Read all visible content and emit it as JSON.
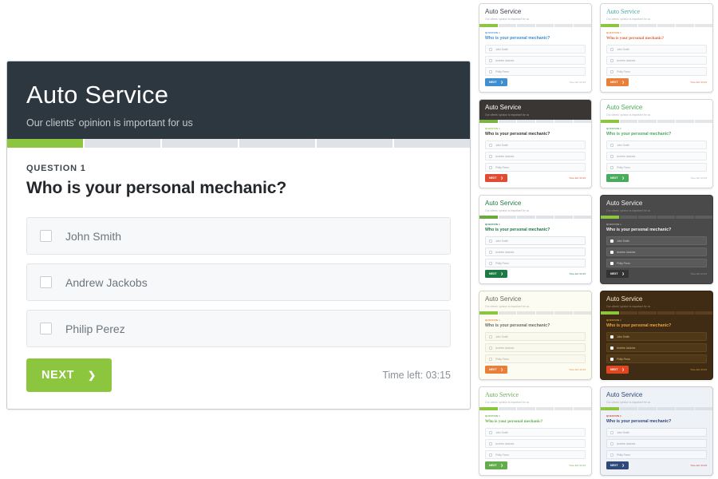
{
  "survey": {
    "title": "Auto Service",
    "subtitle": "Our clients' opinion is important for us",
    "question_label": "QUESTION 1",
    "question": "Who is your personal mechanic?",
    "options": [
      {
        "label": "John Smith",
        "checked": false
      },
      {
        "label": "Andrew Jackobs",
        "checked": false
      },
      {
        "label": "Philip Perez",
        "checked": false
      }
    ],
    "next_label": "NEXT",
    "next_icon": "chevron-right-icon",
    "time_left": "Time left: 03:15",
    "progress": {
      "total_steps": 6,
      "completed_steps": 1,
      "percent": 17
    }
  },
  "theme": {
    "header_bg": "#2d3740",
    "accent": "#8cc63e",
    "option_bg": "#f7f8f9",
    "card_bg": "#ffffff"
  },
  "variants": [
    {
      "name": "light-blue",
      "card_bg": "#ffffff",
      "head_bg": "#ffffff",
      "title_color": "#3d4550",
      "sub_color": "#9aa1a8",
      "title_font": "sans",
      "accent": "#8cc63e",
      "track": "#e3e6e9",
      "qlabel_color": "#3f8fd0",
      "qtitle_color": "#3f8fd0",
      "opt_bg": "#fafbfc",
      "opt_border": "#e6e9ec",
      "opt_text": "#9aa1a8",
      "cb_bg": "#ffffff",
      "cb_border": "#ccd1d6",
      "btn_bg": "#3f8fd0",
      "time_color": "#a8aeb4"
    },
    {
      "name": "serif-teal",
      "card_bg": "#ffffff",
      "head_bg": "#ffffff",
      "title_color": "#3fa9a0",
      "sub_color": "#a0a6ab",
      "title_font": "serif",
      "accent": "#8cc63e",
      "track": "#e3e6e9",
      "qlabel_color": "#e8873a",
      "qtitle_color": "#d8663c",
      "opt_bg": "#fafbfc",
      "opt_border": "#e6e9ec",
      "opt_text": "#a0a6ab",
      "cb_bg": "#ffffff",
      "cb_border": "#ccd1d6",
      "btn_bg": "#e8803a",
      "time_color": "#d8663c"
    },
    {
      "name": "dark-red",
      "card_bg": "#ffffff",
      "head_bg": "#3a3633",
      "title_color": "#ffffff",
      "sub_color": "#b5afa9",
      "title_font": "sans",
      "accent": "#7cb342",
      "track": "#e3e6e9",
      "qlabel_color": "#8cc63e",
      "qtitle_color": "#3a3633",
      "opt_bg": "#fafbfc",
      "opt_border": "#e6e9ec",
      "opt_text": "#9aa1a8",
      "cb_bg": "#ffffff",
      "cb_border": "#ccd1d6",
      "btn_bg": "#e14b33",
      "time_color": "#e14b33"
    },
    {
      "name": "light-green",
      "card_bg": "#ffffff",
      "head_bg": "#ffffff",
      "title_color": "#4aab5e",
      "sub_color": "#a0a6ab",
      "title_font": "sans",
      "accent": "#8cc63e",
      "track": "#e3e6e9",
      "qlabel_color": "#4aab5e",
      "qtitle_color": "#4aab5e",
      "opt_bg": "#fafbfc",
      "opt_border": "#e6e9ec",
      "opt_text": "#a0a6ab",
      "cb_bg": "#ffffff",
      "cb_border": "#ccd1d6",
      "btn_bg": "#4aab5e",
      "time_color": "#a8aeb4"
    },
    {
      "name": "forest-green",
      "card_bg": "#ffffff",
      "head_bg": "#ffffff",
      "title_color": "#1e7a43",
      "sub_color": "#9aa1a8",
      "title_font": "sans",
      "accent": "#6aab3c",
      "track": "#dfe3e8",
      "qlabel_color": "#1e7a43",
      "qtitle_color": "#1e7a43",
      "opt_bg": "#fafbfc",
      "opt_border": "#e0e4e8",
      "opt_text": "#9aa1a8",
      "cb_bg": "#ffffff",
      "cb_border": "#ccd1d6",
      "btn_bg": "#1e7a43",
      "time_color": "#1e7a43"
    },
    {
      "name": "dark-gray",
      "card_bg": "#4a4a4a",
      "head_bg": "#4a4a4a",
      "title_color": "#f0f0f0",
      "sub_color": "#9b9b9b",
      "title_font": "sans",
      "accent": "#8cc63e",
      "track": "#5e5e5e",
      "qlabel_color": "#b4b4b4",
      "qtitle_color": "#f0f0f0",
      "opt_bg": "#5a5a5a",
      "opt_border": "#666666",
      "opt_text": "#c8c8c8",
      "cb_bg": "#ffffff",
      "cb_border": "#ffffff",
      "btn_bg": "#333333",
      "time_color": "#9b9b9b"
    },
    {
      "name": "cream-orange",
      "card_bg": "#fdfcf2",
      "head_bg": "#fdfcf2",
      "title_color": "#6b6a60",
      "sub_color": "#a9a89c",
      "title_font": "sans",
      "accent": "#8cc63e",
      "track": "#e3e6e2",
      "qlabel_color": "#e08a3c",
      "qtitle_color": "#6b6a60",
      "opt_bg": "#faf9ee",
      "opt_border": "#e8e7d8",
      "opt_text": "#a9a89c",
      "cb_bg": "#ffffff",
      "cb_border": "#d5d4c4",
      "btn_bg": "#e8803a",
      "time_color": "#e08a3c"
    },
    {
      "name": "dark-brown",
      "card_bg": "#402c14",
      "head_bg": "#402c14",
      "title_color": "#f5e6c8",
      "sub_color": "#b09a72",
      "title_font": "sans",
      "accent": "#8cc63e",
      "track": "#5a401f",
      "qlabel_color": "#d9a441",
      "qtitle_color": "#e8a33c",
      "opt_bg": "#4e3818",
      "opt_border": "#5e451c",
      "opt_text": "#d9b97e",
      "cb_bg": "#ffffff",
      "cb_border": "#ffffff",
      "btn_bg": "#e0461f",
      "time_color": "#d9a441"
    },
    {
      "name": "serif-green",
      "card_bg": "#ffffff",
      "head_bg": "#ffffff",
      "title_color": "#63ac4c",
      "sub_color": "#a0a6ab",
      "title_font": "serif",
      "accent": "#8cc63e",
      "track": "#e3e6e9",
      "qlabel_color": "#63ac4c",
      "qtitle_color": "#63ac4c",
      "opt_bg": "#fafbfc",
      "opt_border": "#e6e9ec",
      "opt_text": "#a0a6ab",
      "cb_bg": "#ffffff",
      "cb_border": "#ccd1d6",
      "btn_bg": "#63ac4c",
      "time_color": "#63ac4c"
    },
    {
      "name": "navy-blue",
      "card_bg": "#eef2f7",
      "head_bg": "#eef2f7",
      "title_color": "#2f4a7a",
      "sub_color": "#96a0af",
      "title_font": "sans",
      "accent": "#8cc63e",
      "track": "#dae0e8",
      "qlabel_color": "#c0392b",
      "qtitle_color": "#2f4a7a",
      "opt_bg": "#f6f8fb",
      "opt_border": "#dde3ea",
      "opt_text": "#96a0af",
      "cb_bg": "#ffffff",
      "cb_border": "#ccd3dc",
      "btn_bg": "#2f4a7a",
      "time_color": "#c0392b"
    }
  ]
}
